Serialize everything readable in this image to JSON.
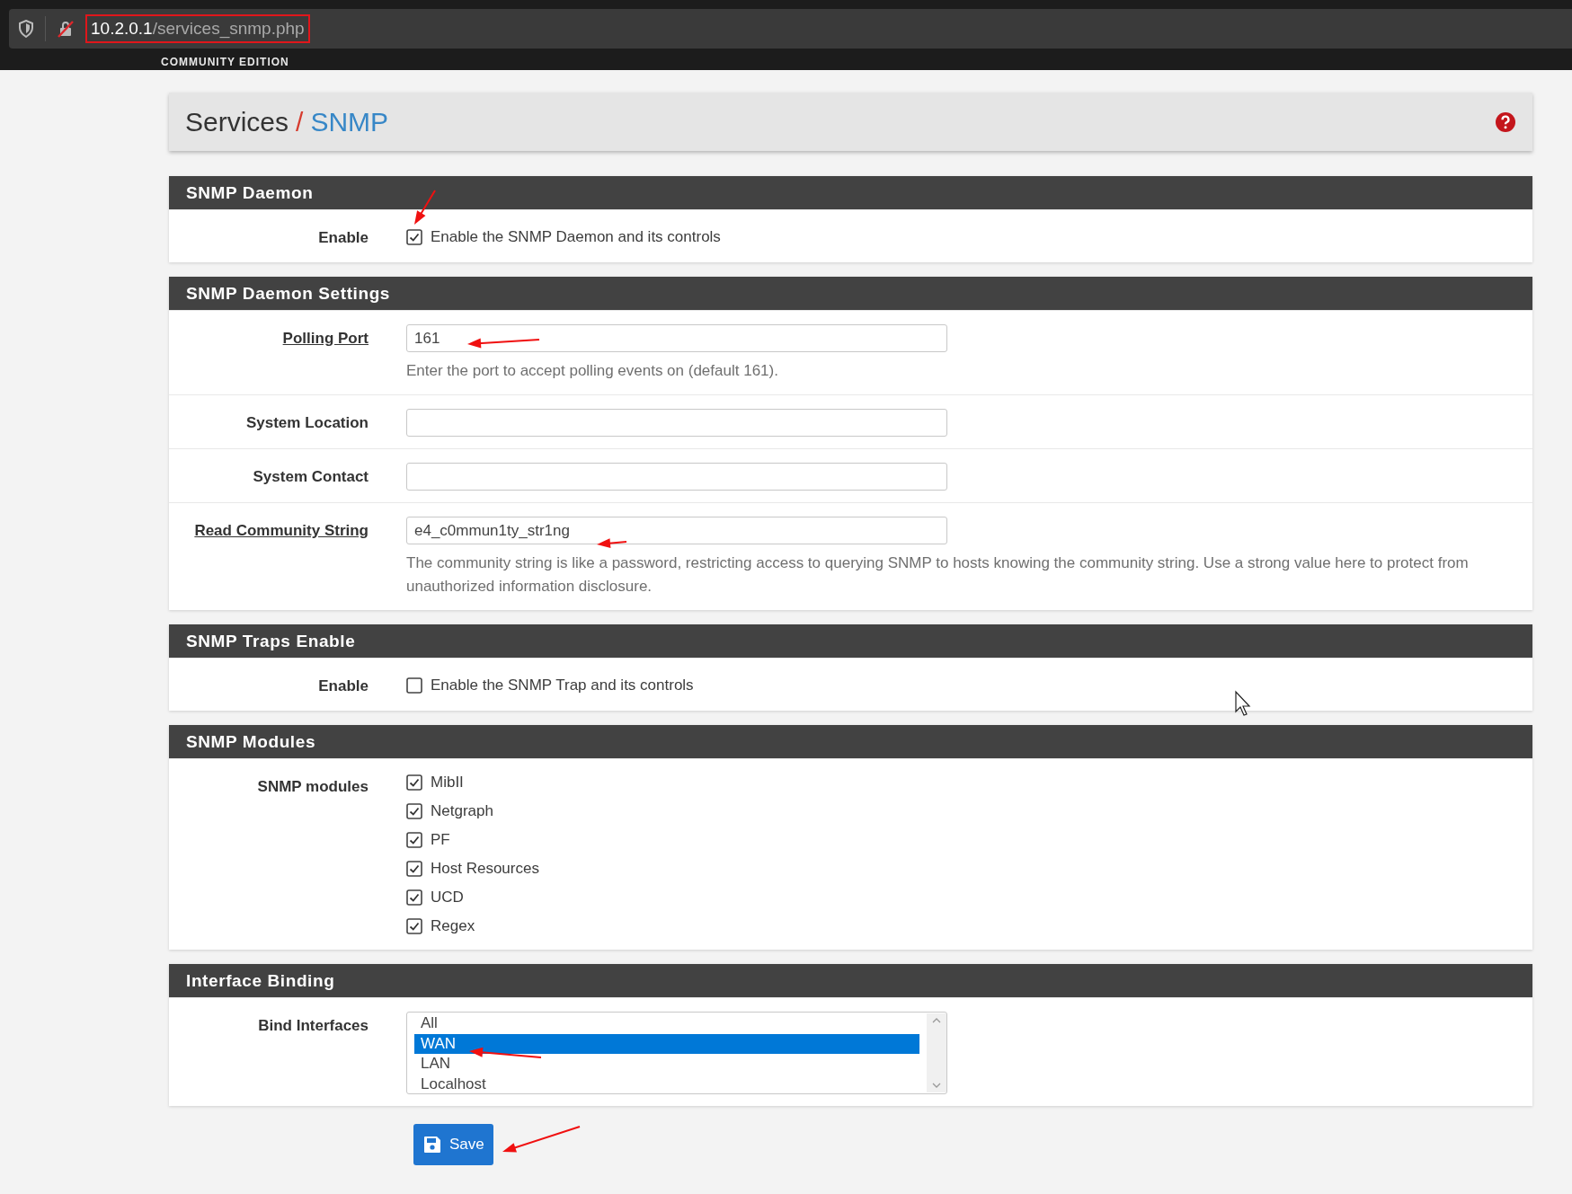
{
  "browser": {
    "url_host": "10.2.0.1",
    "url_path": "/services_snmp.php"
  },
  "brand_bar": {
    "edition": "COMMUNITY EDITION"
  },
  "breadcrumb": {
    "parent": "Services",
    "separator": "/",
    "current": "SNMP"
  },
  "sections": [
    {
      "title": "SNMP Daemon",
      "rows": [
        {
          "kind": "checkbox",
          "label": "Enable",
          "label_link": false,
          "checked": true,
          "text": "Enable the SNMP Daemon and its controls"
        }
      ]
    },
    {
      "title": "SNMP Daemon Settings",
      "rows": [
        {
          "kind": "input",
          "label": "Polling Port",
          "label_link": true,
          "value": "161",
          "help": "Enter the port to accept polling events on (default 161)."
        },
        {
          "kind": "input",
          "label": "System Location",
          "label_link": false
        },
        {
          "kind": "input",
          "label": "System Contact",
          "label_link": false
        },
        {
          "kind": "input",
          "label": "Read Community String",
          "label_link": true,
          "value": "e4_c0mmun1ty_str1ng",
          "help": "The community string is like a password, restricting access to querying SNMP to hosts knowing the community string. Use a strong value here to protect from unauthorized information disclosure."
        }
      ]
    },
    {
      "title": "SNMP Traps Enable",
      "rows": [
        {
          "kind": "checkbox",
          "label": "Enable",
          "label_link": false,
          "checked": false,
          "text": "Enable the SNMP Trap and its controls"
        }
      ]
    },
    {
      "title": "SNMP Modules",
      "rows": [
        {
          "kind": "checklist",
          "label": "SNMP modules",
          "label_link": false,
          "options": [
            {
              "text": "MibII",
              "checked": true
            },
            {
              "text": "Netgraph",
              "checked": true
            },
            {
              "text": "PF",
              "checked": true
            },
            {
              "text": "Host Resources",
              "checked": true
            },
            {
              "text": "UCD",
              "checked": true
            },
            {
              "text": "Regex",
              "checked": true
            }
          ]
        }
      ]
    },
    {
      "title": "Interface Binding",
      "rows": [
        {
          "kind": "listbox",
          "label": "Bind Interfaces",
          "label_link": false,
          "options": [
            {
              "text": "All",
              "selected": false
            },
            {
              "text": "WAN",
              "selected": true
            },
            {
              "text": "LAN",
              "selected": false
            },
            {
              "text": "Localhost",
              "selected": false
            }
          ]
        }
      ]
    }
  ],
  "save_button": {
    "label": "Save"
  }
}
